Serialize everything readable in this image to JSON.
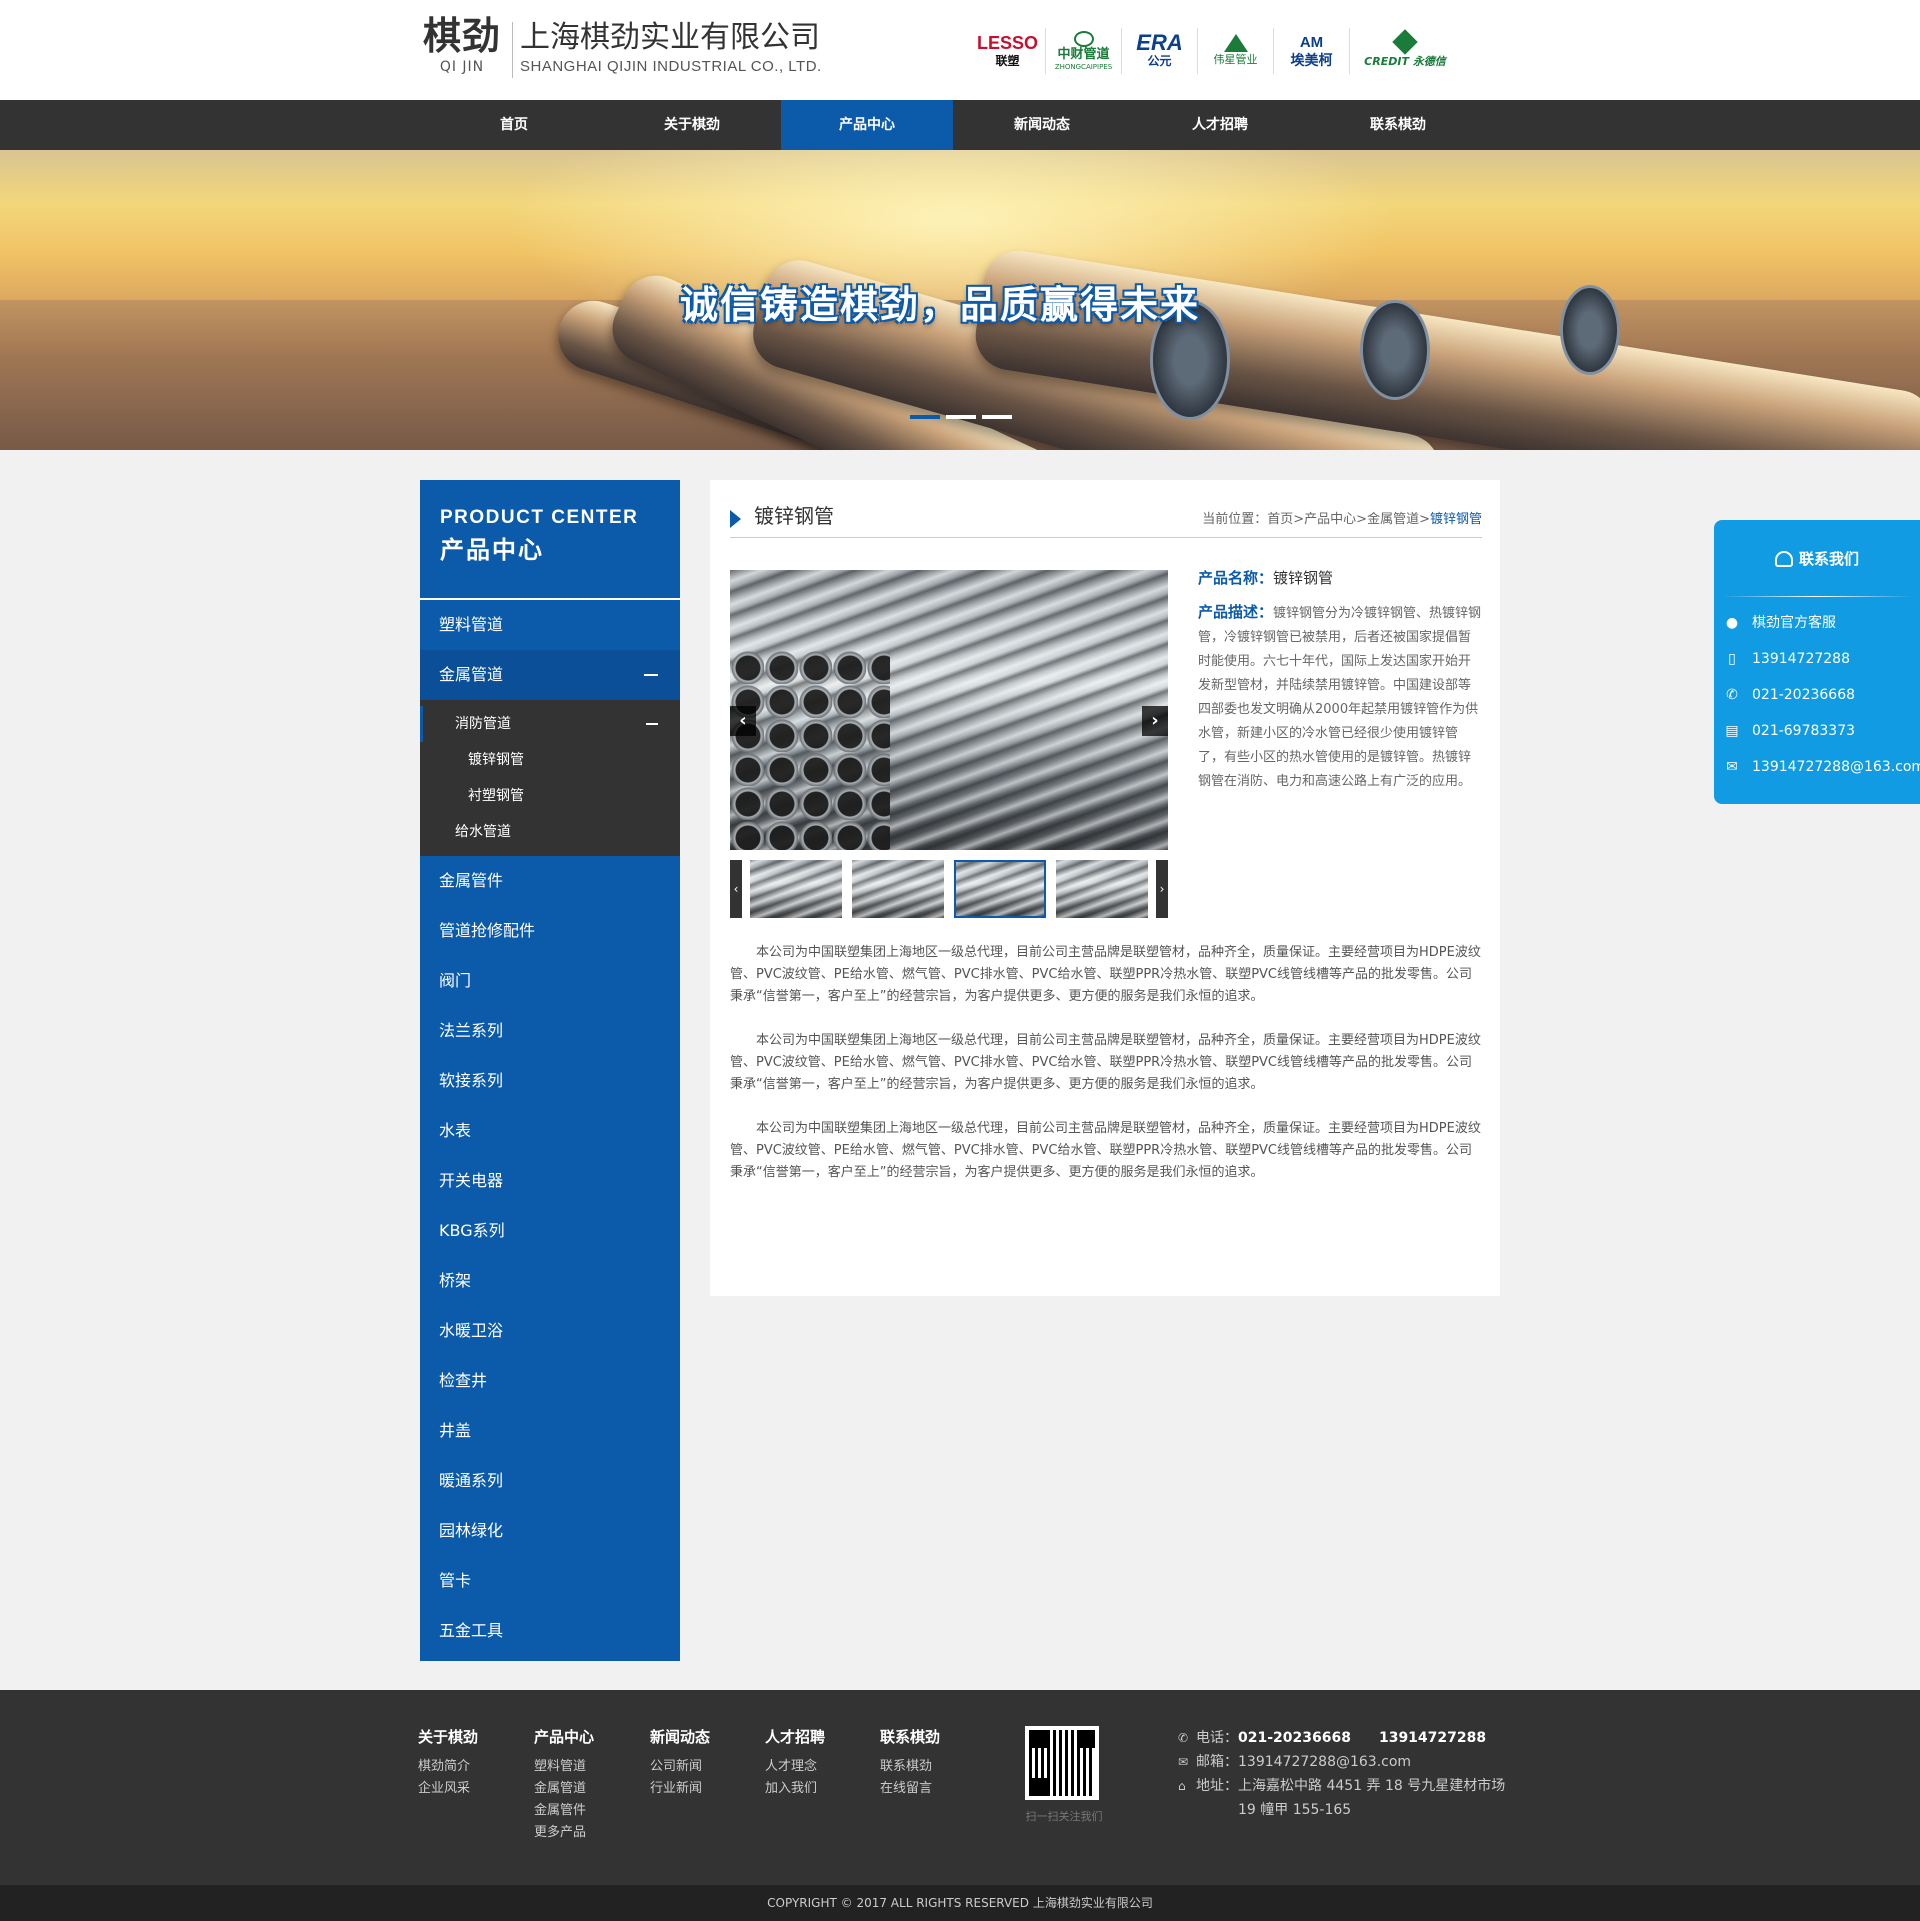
{
  "header": {
    "logo_cn": "棋劲",
    "logo_en": "QI JIN",
    "company_cn": "上海棋劲实业有限公司",
    "company_en": "SHANGHAI QIJIN INDUSTRIAL CO., LTD.",
    "brands": [
      {
        "line1": "LESSO",
        "line2": "联塑",
        "color": "#c8102e"
      },
      {
        "line1": "中财管道",
        "line2": "ZHONGCAIPIPES",
        "color": "#1a7b3a"
      },
      {
        "line1": "ERA",
        "line2": "公元",
        "color": "#0c3f8c"
      },
      {
        "line1": "伟星管业",
        "line2": "",
        "color": "#1a7b3a"
      },
      {
        "line1": "AM",
        "line2": "埃美柯",
        "color": "#0c3f8c"
      },
      {
        "line1": "CREDIT",
        "line2": "永德信",
        "color": "#1a7b3a"
      }
    ]
  },
  "nav": {
    "items": [
      "首页",
      "关于棋劲",
      "产品中心",
      "新闻动态",
      "人才招聘",
      "联系棋劲"
    ],
    "active": "产品中心"
  },
  "banner": {
    "slogan": "诚信铸造棋劲，品质赢得未来",
    "slide_count": 3,
    "active_slide": 1
  },
  "sidebar": {
    "title_en": "PRODUCT CENTER",
    "title_cn": "产品中心",
    "items_top": [
      "塑料管道"
    ],
    "open_item": "金属管道",
    "sub_open": "消防管道",
    "sub_sub_items": [
      "镀锌钢管",
      "衬塑钢管"
    ],
    "sub_other": "给水管道",
    "items_rest": [
      "金属管件",
      "管道抢修配件",
      "阀门",
      "法兰系列",
      "软接系列",
      "水表",
      "开关电器",
      "KBG系列",
      "桥架",
      "水暖卫浴",
      "检查井",
      "井盖",
      "暖通系列",
      "园林绿化",
      "管卡",
      "五金工具"
    ]
  },
  "main": {
    "title": "镀锌钢管",
    "breadcrumb_label": "当前位置：",
    "breadcrumb": [
      "首页",
      "产品中心",
      "金属管道"
    ],
    "breadcrumb_current": "镀锌钢管",
    "breadcrumb_sep": ">",
    "product_name_label": "产品名称：",
    "product_name": "镀锌钢管",
    "product_desc_label": "产品描述：",
    "product_desc": "镀锌钢管分为冷镀锌钢管、热镀锌钢管，冷镀锌钢管已被禁用，后者还被国家提倡暂时能使用。六七十年代，国际上发达国家开始开发新型管材，并陆续禁用镀锌管。中国建设部等四部委也发文明确从2000年起禁用镀锌管作为供水管，新建小区的冷水管已经很少使用镀锌管了，有些小区的热水管使用的是镀锌管。热镀锌钢管在消防、电力和高速公路上有广泛的应用。",
    "thumbnail_count": 4,
    "active_thumbnail": 3,
    "paragraphs": [
      "本公司为中国联塑集团上海地区一级总代理，目前公司主营品牌是联塑管材，品种齐全，质量保证。主要经营项目为HDPE波纹管、PVC波纹管、PE给水管、燃气管、PVC排水管、PVC给水管、联塑PPR冷热水管、联塑PVC线管线槽等产品的批发零售。公司秉承“信誉第一，客户至上”的经营宗旨，为客户提供更多、更方便的服务是我们永恒的追求。",
      "本公司为中国联塑集团上海地区一级总代理，目前公司主营品牌是联塑管材，品种齐全，质量保证。主要经营项目为HDPE波纹管、PVC波纹管、PE给水管、燃气管、PVC排水管、PVC给水管、联塑PPR冷热水管、联塑PVC线管线槽等产品的批发零售。公司秉承“信誉第一，客户至上”的经营宗旨，为客户提供更多、更方便的服务是我们永恒的追求。",
      "本公司为中国联塑集团上海地区一级总代理，目前公司主营品牌是联塑管材，品种齐全，质量保证。主要经营项目为HDPE波纹管、PVC波纹管、PE给水管、燃气管、PVC排水管、PVC给水管、联塑PPR冷热水管、联塑PVC线管线槽等产品的批发零售。公司秉承“信誉第一，客户至上”的经营宗旨，为客户提供更多、更方便的服务是我们永恒的追求。"
    ]
  },
  "float_contact": {
    "title": "联系我们",
    "items": [
      {
        "icon": "qq-icon",
        "text": "棋劲官方客服"
      },
      {
        "icon": "mobile-icon",
        "text": "13914727288"
      },
      {
        "icon": "phone-icon",
        "text": "021-20236668"
      },
      {
        "icon": "fax-icon",
        "text": "021-69783373"
      },
      {
        "icon": "mail-icon",
        "text": "13914727288@163.com"
      }
    ]
  },
  "footer": {
    "columns": [
      {
        "title": "关于棋劲",
        "links": [
          "棋劲简介",
          "企业风采"
        ]
      },
      {
        "title": "产品中心",
        "links": [
          "塑料管道",
          "金属管道",
          "金属管件",
          "更多产品"
        ]
      },
      {
        "title": "新闻动态",
        "links": [
          "公司新闻",
          "行业新闻"
        ]
      },
      {
        "title": "人才招聘",
        "links": [
          "人才理念",
          "加入我们"
        ]
      },
      {
        "title": "联系棋劲",
        "links": [
          "联系棋劲",
          "在线留言"
        ]
      }
    ],
    "qr_caption": "扫一扫关注我们",
    "phone_label": "电话：",
    "phone_values": "021-20236668　　13914727288",
    "email_label": "邮箱：",
    "email": "13914727288@163.com",
    "address_label": "地址：",
    "address_line1": "上海嘉松中路 4451 弄 18 号九星建材市场",
    "address_line2": "19 幢甲 155-165",
    "copyright": "COPYRIGHT © 2017 ALL RIGHTS RESERVED 上海棋劲实业有限公司"
  },
  "colors": {
    "primary": "#0c5aaa",
    "nav_bg": "#333333",
    "float_bg": "#119be3",
    "footer_bg": "#333333"
  }
}
